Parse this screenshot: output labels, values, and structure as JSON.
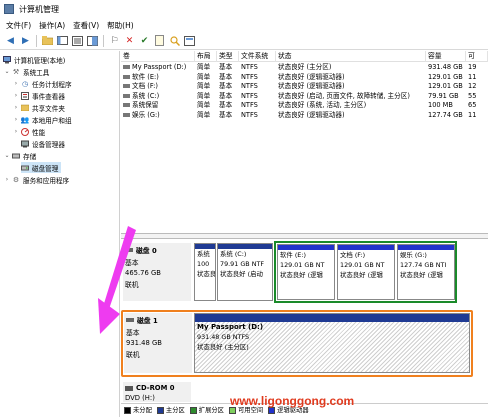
{
  "window": {
    "title": "计算机管理"
  },
  "menu": [
    "文件(F)",
    "操作(A)",
    "查看(V)",
    "帮助(H)"
  ],
  "tree": {
    "root": "计算机管理(本地)",
    "system_tools": "系统工具",
    "task_scheduler": "任务计划程序",
    "event_viewer": "事件查看器",
    "shared_folders": "共享文件夹",
    "local_users": "本地用户和组",
    "performance": "性能",
    "device_manager": "设备管理器",
    "storage": "存储",
    "disk_management": "磁盘管理",
    "services": "服务和应用程序"
  },
  "volumes": {
    "headers": [
      "卷",
      "布局",
      "类型",
      "文件系统",
      "状态",
      "容量",
      "可"
    ],
    "rows": [
      [
        "My Passport (D:)",
        "简单",
        "基本",
        "NTFS",
        "状态良好 (主分区)",
        "931.48 GB",
        "19"
      ],
      [
        "软件 (E:)",
        "简单",
        "基本",
        "NTFS",
        "状态良好 (逻辑驱动器)",
        "129.01 GB",
        "11"
      ],
      [
        "文档 (F:)",
        "简单",
        "基本",
        "NTFS",
        "状态良好 (逻辑驱动器)",
        "129.01 GB",
        "12"
      ],
      [
        "系统 (C:)",
        "简单",
        "基本",
        "NTFS",
        "状态良好 (启动, 页面文件, 故障转储, 主分区)",
        "79.91 GB",
        "55"
      ],
      [
        "系统保留",
        "简单",
        "基本",
        "NTFS",
        "状态良好 (系统, 活动, 主分区)",
        "100 MB",
        "65"
      ],
      [
        "娱乐 (G:)",
        "简单",
        "基本",
        "NTFS",
        "状态良好 (逻辑驱动器)",
        "127.74 GB",
        "11"
      ]
    ]
  },
  "disk0": {
    "name": "磁盘 0",
    "type": "基本",
    "size": "465.76 GB",
    "status": "联机",
    "partitions": [
      {
        "name": "系统",
        "size": "100",
        "status": "状态良"
      },
      {
        "name": "系统 (C:)",
        "size": "79.91 GB NTF",
        "status": "状态良好 (启动"
      },
      {
        "name": "软件 (E:)",
        "size": "129.01 GB NT",
        "status": "状态良好 (逻辑"
      },
      {
        "name": "文档 (F:)",
        "size": "129.01 GB NT",
        "status": "状态良好 (逻辑"
      },
      {
        "name": "娱乐 (G:)",
        "size": "127.74 GB NTI",
        "status": "状态良好 (逻辑"
      }
    ]
  },
  "disk1": {
    "name": "磁盘 1",
    "type": "基本",
    "size": "931.48 GB",
    "status": "联机",
    "partition": {
      "name": "My Passport (D:)",
      "size": "931.48 GB NTFS",
      "status": "状态良好 (主分区)"
    }
  },
  "cdrom0": {
    "name": "CD-ROM 0",
    "type": "DVD (H:)"
  },
  "legend": [
    "未分配",
    "主分区",
    "扩展分区",
    "可用空间",
    "逻辑驱动器"
  ],
  "colors": {
    "unallocated": "#000000",
    "primary": "#1f3a93",
    "extended": "#2e8b2e",
    "free": "#7fcf5f",
    "logical": "#2233cc",
    "arrow": "#ee3bf0",
    "highlight_green": "#1a8a2a",
    "highlight_orange": "#f0801e"
  },
  "watermark": "www.ligonggong.com"
}
